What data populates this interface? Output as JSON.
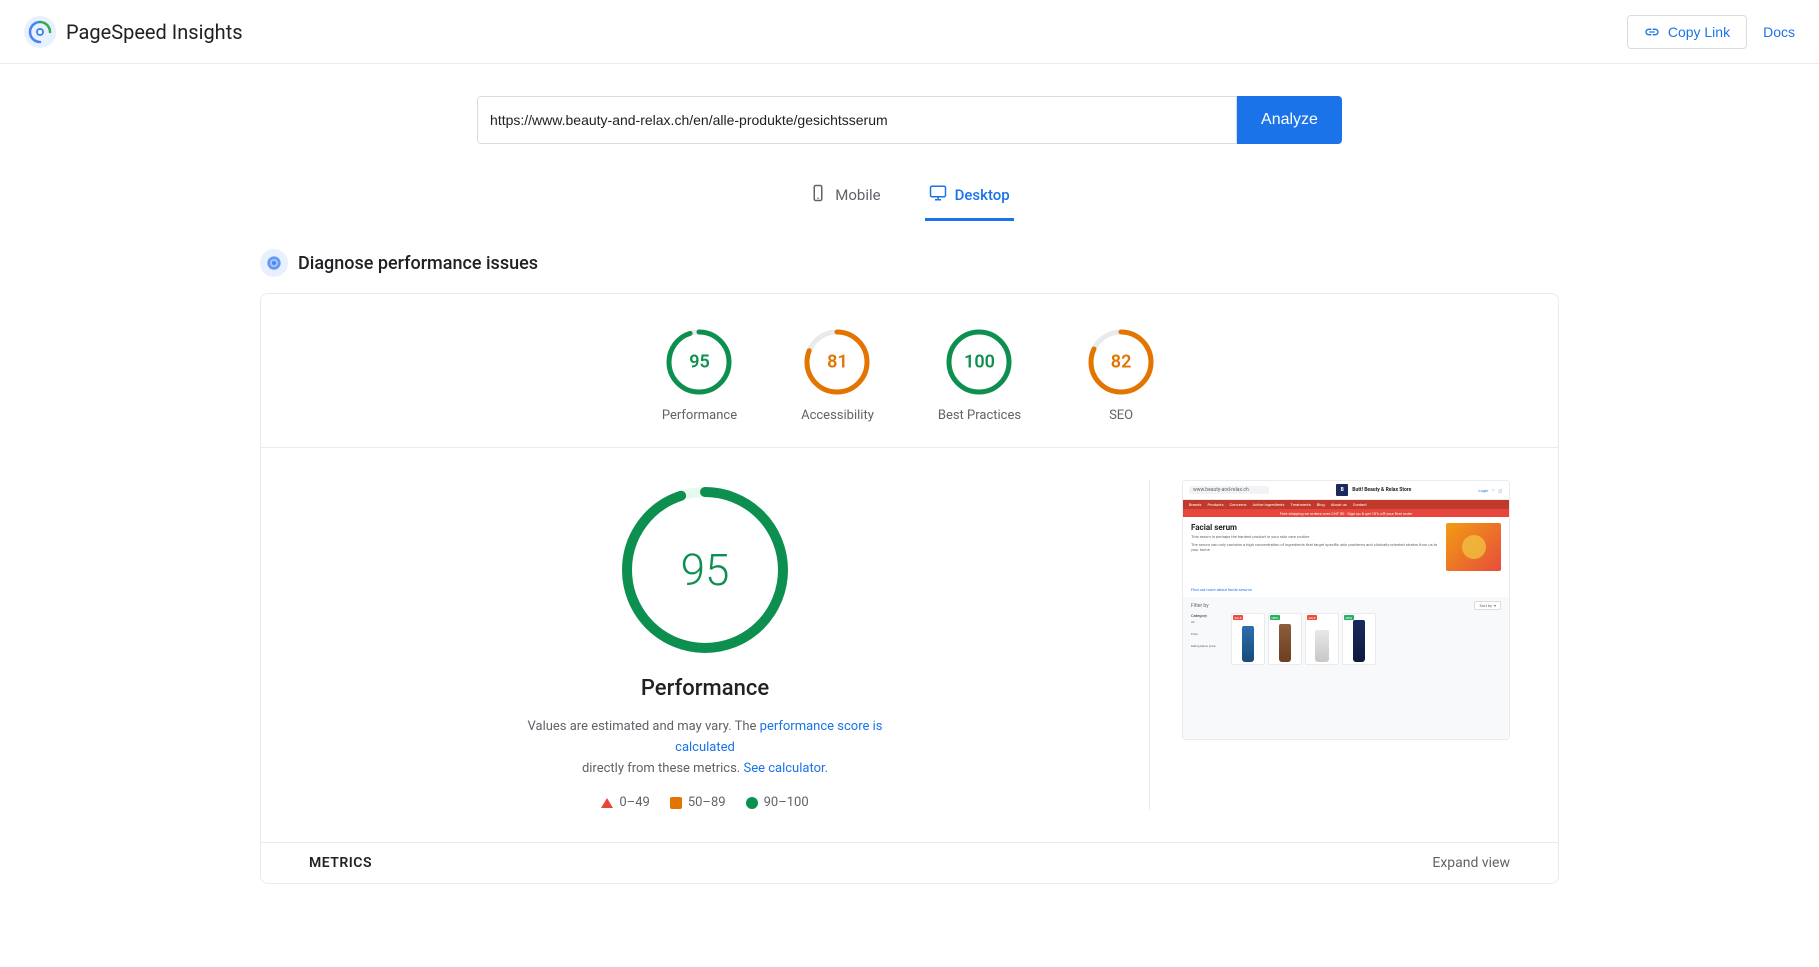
{
  "header": {
    "title": "PageSpeed Insights",
    "copy_link_label": "Copy Link",
    "docs_label": "Docs"
  },
  "url_bar": {
    "url_value": "https://www.beauty-and-relax.ch/en/alle-produkte/gesichtsserum",
    "analyze_label": "Analyze"
  },
  "tabs": [
    {
      "id": "mobile",
      "label": "Mobile",
      "icon": "📱",
      "active": false
    },
    {
      "id": "desktop",
      "label": "Desktop",
      "icon": "🖥",
      "active": true
    }
  ],
  "diagnose": {
    "title": "Diagnose performance issues"
  },
  "scores": [
    {
      "id": "performance",
      "value": 95,
      "label": "Performance",
      "color_class": "green",
      "stroke_color": "#0d904f",
      "pct": 95
    },
    {
      "id": "accessibility",
      "value": 81,
      "label": "Accessibility",
      "color_class": "orange",
      "stroke_color": "#e37400",
      "pct": 81
    },
    {
      "id": "best-practices",
      "value": 100,
      "label": "Best Practices",
      "color_class": "green",
      "stroke_color": "#0d904f",
      "pct": 100
    },
    {
      "id": "seo",
      "value": 82,
      "label": "SEO",
      "color_class": "orange",
      "stroke_color": "#e37400",
      "pct": 82
    }
  ],
  "main_score": {
    "value": 95,
    "label": "Performance",
    "description_part1": "Values are estimated and may vary. The",
    "description_link1": "performance score is calculated",
    "description_part2": "directly from these metrics.",
    "description_link2": "See calculator.",
    "circumference": 502.65
  },
  "legend": [
    {
      "id": "poor",
      "range": "0–49",
      "color": "red"
    },
    {
      "id": "needs-improvement",
      "range": "50–89",
      "color": "orange"
    },
    {
      "id": "good",
      "range": "90–100",
      "color": "green"
    }
  ],
  "metrics_footer": {
    "metrics_label": "METRICS",
    "expand_label": "Expand view"
  },
  "preview": {
    "site_title": "Butt! Beauty & Relax Store",
    "page_title": "Facial serum",
    "page_desc": "This serum is perhaps the hardest product in your skin care routine",
    "page_desc2": "The serum can only contains a high concentration of ingredients that target specific skin problems and clinically-oriented strains from us to your home",
    "filter_label": "Filter by",
    "sort_label": "Sort by",
    "category_label": "Category",
    "price_label": "Price",
    "rating_label": "Rating below price"
  }
}
